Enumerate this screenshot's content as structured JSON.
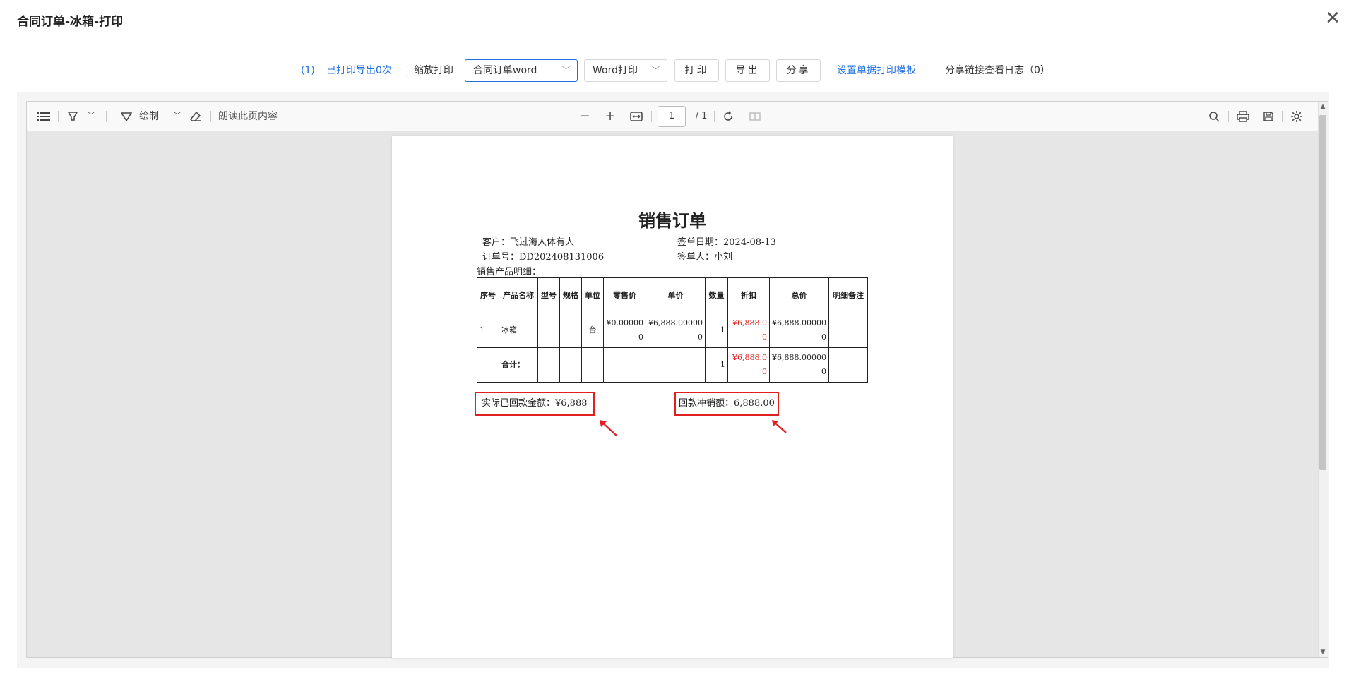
{
  "dialog": {
    "title": "合同订单-冰箱-打印",
    "close_glyph": "✕"
  },
  "toolbar": {
    "print_count": "(1)",
    "printed_status": "已打印导出0次",
    "scale_print_label": "缩放打印",
    "template_select": "合同订单word",
    "print_mode_select": "Word打印",
    "print_button": "打印",
    "export_button": "导出",
    "share_button": "分享",
    "template_settings_link": "设置单据打印模板",
    "share_log_link": "分享链接查看日志（0）"
  },
  "viewer": {
    "draw_label": "绘制",
    "read_aloud_label": "朗读此页内容",
    "current_page": "1",
    "total_pages": "/ 1",
    "icons": [
      "list-icon",
      "highlight-icon",
      "draw-icon",
      "eraser-icon",
      "zoom-out-icon",
      "zoom-in-icon",
      "fit-width-icon",
      "rotate-icon",
      "page-view-icon",
      "search-icon",
      "print-icon",
      "save-icon",
      "settings-icon"
    ]
  },
  "document": {
    "title": "销售订单",
    "customer": "客户：飞过海人体有人",
    "sign_date": "签单日期：2024-08-13",
    "order_no": "订单号：DD202408131006",
    "signer": "签单人：小刘",
    "detail_label": "销售产品明细：",
    "table": {
      "headers": [
        "序号",
        "产品名称",
        "型号",
        "规格",
        "单位",
        "零售价",
        "单价",
        "数量",
        "折扣",
        "总价",
        "明细备注"
      ],
      "rows": [
        [
          "1",
          "冰箱",
          "",
          "",
          "台",
          "¥0.000000",
          "¥6,888.000000",
          "1",
          "¥6,888.00",
          "¥6,888.000000",
          ""
        ]
      ],
      "total_row": [
        "",
        "合计：",
        "",
        "",
        "",
        "",
        "",
        "1",
        "¥6,888.00",
        "¥6,888.000000",
        ""
      ]
    },
    "actual_received": "实际已回款金额：¥6,888",
    "offset_amount": "回款冲销额：6,888.00"
  },
  "colors": {
    "accent": "#1f6fe0",
    "highlight": "#e02020"
  }
}
